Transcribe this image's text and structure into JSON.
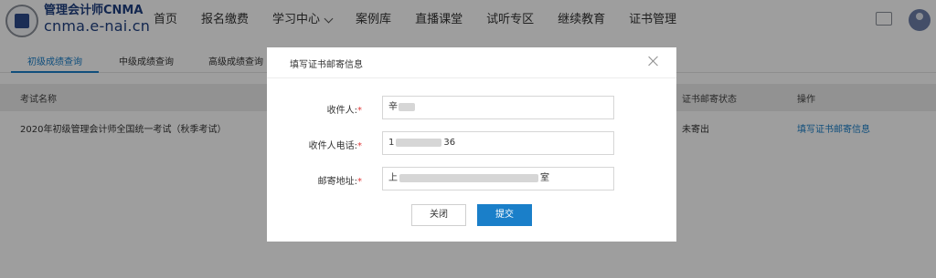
{
  "header": {
    "brand_name": "管理会计师CNMA",
    "brand_url": "cnma.e-nai.cn",
    "nav": [
      "首页",
      "报名缴费",
      "学习中心",
      "案例库",
      "直播课堂",
      "试听专区",
      "继续教育",
      "证书管理"
    ]
  },
  "tabs": [
    "初级成绩查询",
    "中级成绩查询",
    "高级成绩查询"
  ],
  "table": {
    "headers": [
      "考试名称",
      "证书邮寄状态",
      "操作"
    ],
    "rows": [
      {
        "exam_name": "2020年初级管理会计师全国统一考试（秋季考试）",
        "status": "未寄出",
        "action": "填写证书邮寄信息"
      }
    ]
  },
  "modal": {
    "title": "填写证书邮寄信息",
    "fields": [
      {
        "label": "收件人:",
        "required": "*",
        "value_prefix": "辛",
        "value_suffix": ""
      },
      {
        "label": "收件人电话:",
        "required": "*",
        "value_prefix": "1",
        "value_suffix": "36"
      },
      {
        "label": "邮寄地址:",
        "required": "*",
        "value_prefix": "上",
        "value_suffix": "室"
      }
    ],
    "close_label": "关闭",
    "submit_label": "提交"
  },
  "colors": {
    "accent": "#1a7fc9",
    "required": "#e03a3a",
    "brand": "#1f3f80"
  }
}
